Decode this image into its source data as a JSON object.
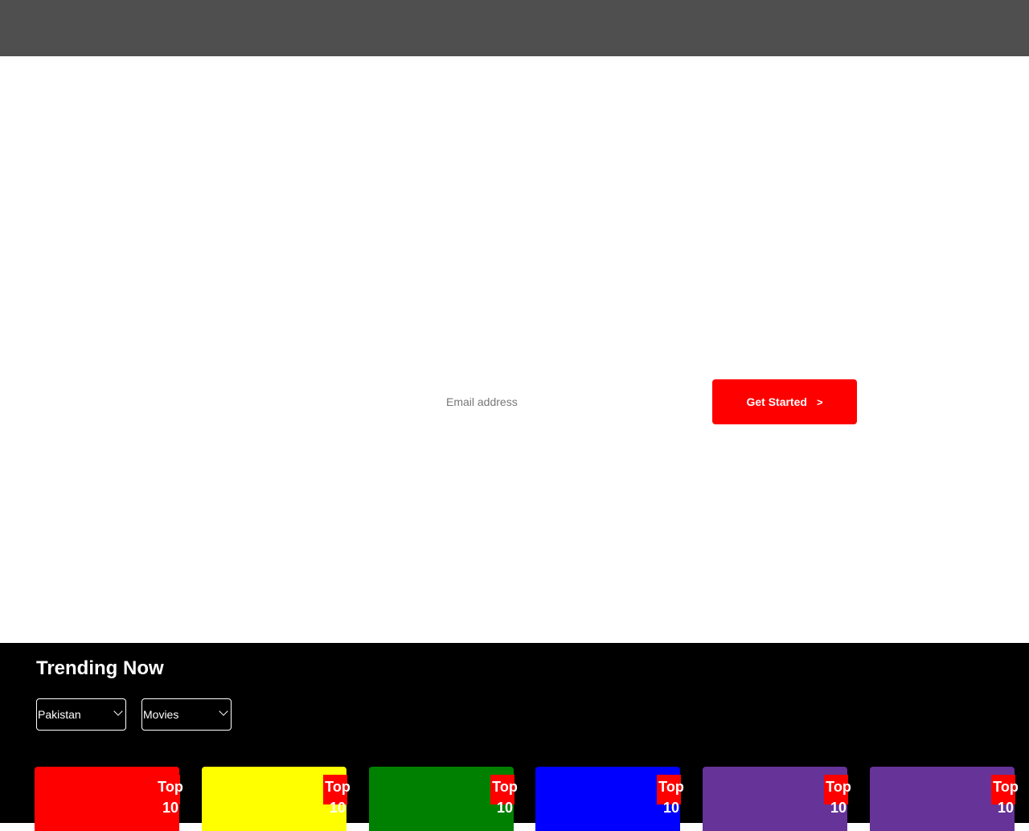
{
  "hero": {
    "email_placeholder": "Email address",
    "cta_label": "Get Started",
    "cta_chevron": ">"
  },
  "trending": {
    "title": "Trending Now",
    "country_selected": "Pakistan",
    "type_selected": "Movies",
    "cards": [
      {
        "color": "#ff0000",
        "badge_line1": "Top",
        "badge_line2": "10"
      },
      {
        "color": "#ffff00",
        "badge_line1": "Top",
        "badge_line2": "10"
      },
      {
        "color": "#008000",
        "badge_line1": "Top",
        "badge_line2": "10"
      },
      {
        "color": "#0000ff",
        "badge_line1": "Top",
        "badge_line2": "10"
      },
      {
        "color": "#663399",
        "badge_line1": "Top",
        "badge_line2": "10"
      },
      {
        "color": "#663399",
        "badge_line1": "Top",
        "badge_line2": "10"
      }
    ]
  },
  "colors": {
    "topbar": "#4f4f4f",
    "accent": "#ff0000",
    "trending_bg": "#000000"
  }
}
